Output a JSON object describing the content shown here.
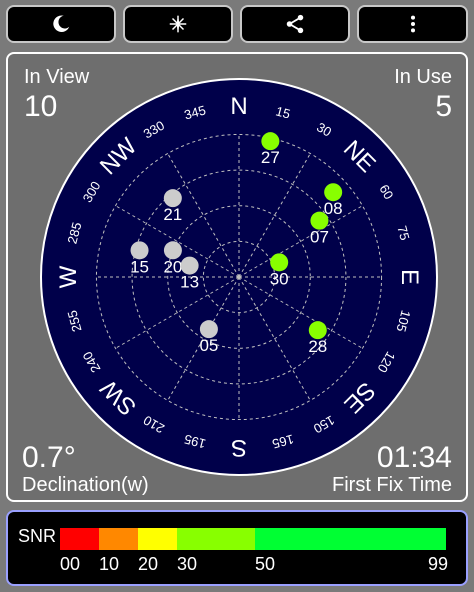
{
  "toolbar": {
    "buttons": [
      {
        "icon": "moon-icon"
      },
      {
        "icon": "compass-star-icon"
      },
      {
        "icon": "share-icon"
      },
      {
        "icon": "more-vert-icon"
      }
    ]
  },
  "status": {
    "in_view_label": "In View",
    "in_view_value": "10",
    "in_use_label": "In Use",
    "in_use_value": "5",
    "declination_value": "0.7°",
    "declination_label": "Declination(w)",
    "fix_time_value": "01:34",
    "fix_time_label": "First Fix Time"
  },
  "sky": {
    "cardinals": [
      {
        "text": "N",
        "az": 0
      },
      {
        "text": "NE",
        "az": 45
      },
      {
        "text": "E",
        "az": 90
      },
      {
        "text": "SE",
        "az": 135
      },
      {
        "text": "S",
        "az": 180
      },
      {
        "text": "SW",
        "az": 225
      },
      {
        "text": "W",
        "az": 270
      },
      {
        "text": "NW",
        "az": 315
      }
    ],
    "degree_labels": [
      "15",
      "30",
      "60",
      "75",
      "105",
      "120",
      "150",
      "165",
      "195",
      "210",
      "240",
      "255",
      "285",
      "300",
      "330",
      "345"
    ],
    "satellites": [
      {
        "prn": "27",
        "az": 13,
        "el": 2,
        "used": true
      },
      {
        "prn": "08",
        "az": 48,
        "el": 10,
        "used": true
      },
      {
        "prn": "07",
        "az": 55,
        "el": 28,
        "used": true
      },
      {
        "prn": "30",
        "az": 70,
        "el": 63,
        "used": true
      },
      {
        "prn": "28",
        "az": 124,
        "el": 30,
        "used": true
      },
      {
        "prn": "21",
        "az": 320,
        "el": 25,
        "used": false
      },
      {
        "prn": "20",
        "az": 292,
        "el": 45,
        "used": false
      },
      {
        "prn": "15",
        "az": 285,
        "el": 25,
        "used": false
      },
      {
        "prn": "13",
        "az": 283,
        "el": 58,
        "used": false
      },
      {
        "prn": "05",
        "az": 210,
        "el": 52,
        "used": false
      }
    ],
    "colors": {
      "disc": "#00004a",
      "used": "#88ff00",
      "unused": "#cccccc"
    }
  },
  "snr": {
    "title": "SNR",
    "ticks": [
      "00",
      "10",
      "20",
      "30",
      "50",
      "99"
    ],
    "segments": [
      {
        "from": 0,
        "to": 10,
        "color": "#ff0000"
      },
      {
        "from": 10,
        "to": 20,
        "color": "#ff8800"
      },
      {
        "from": 20,
        "to": 30,
        "color": "#ffff00"
      },
      {
        "from": 30,
        "to": 50,
        "color": "#88ff00"
      },
      {
        "from": 50,
        "to": 99,
        "color": "#00ff33"
      }
    ]
  }
}
